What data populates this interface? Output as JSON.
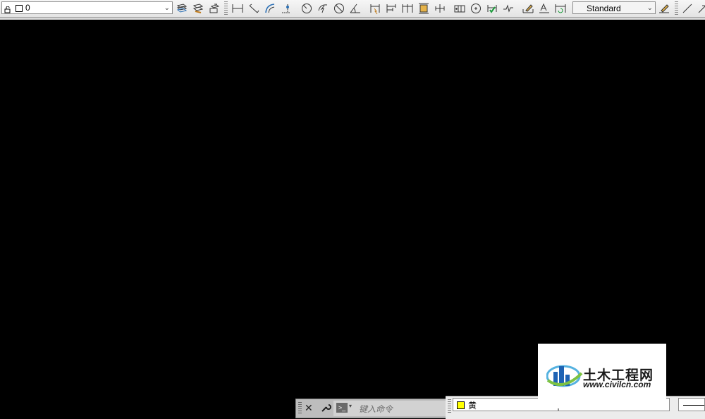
{
  "layer_toolbar": {
    "current_layer": "0",
    "icons": [
      "layer-lock-icon",
      "layer-color-swatch-icon",
      "layer-properties-icon",
      "layer-states-icon",
      "make-current-layer-icon"
    ]
  },
  "dimension_toolbar": {
    "icons": [
      "linear-dimension-icon",
      "aligned-dimension-icon",
      "arc-length-icon",
      "ordinate-icon",
      "radius-icon",
      "jogged-icon",
      "diameter-icon",
      "angular-icon",
      "quick-dimension-icon",
      "baseline-icon",
      "continue-icon",
      "dimension-space-icon",
      "dimension-break-icon",
      "tolerance-icon",
      "center-mark-icon",
      "inspection-icon",
      "jogged-linear-icon",
      "edit-dimension-icon",
      "edit-text-icon",
      "update-dimension-icon"
    ]
  },
  "dim_style": {
    "current": "Standard"
  },
  "command_line": {
    "placeholder": "键入命令"
  },
  "properties_bar": {
    "color_label": "黄",
    "color_hex": "#ffff00"
  },
  "watermark": {
    "name": "土木工程网",
    "url": "www.civilcn.com"
  }
}
